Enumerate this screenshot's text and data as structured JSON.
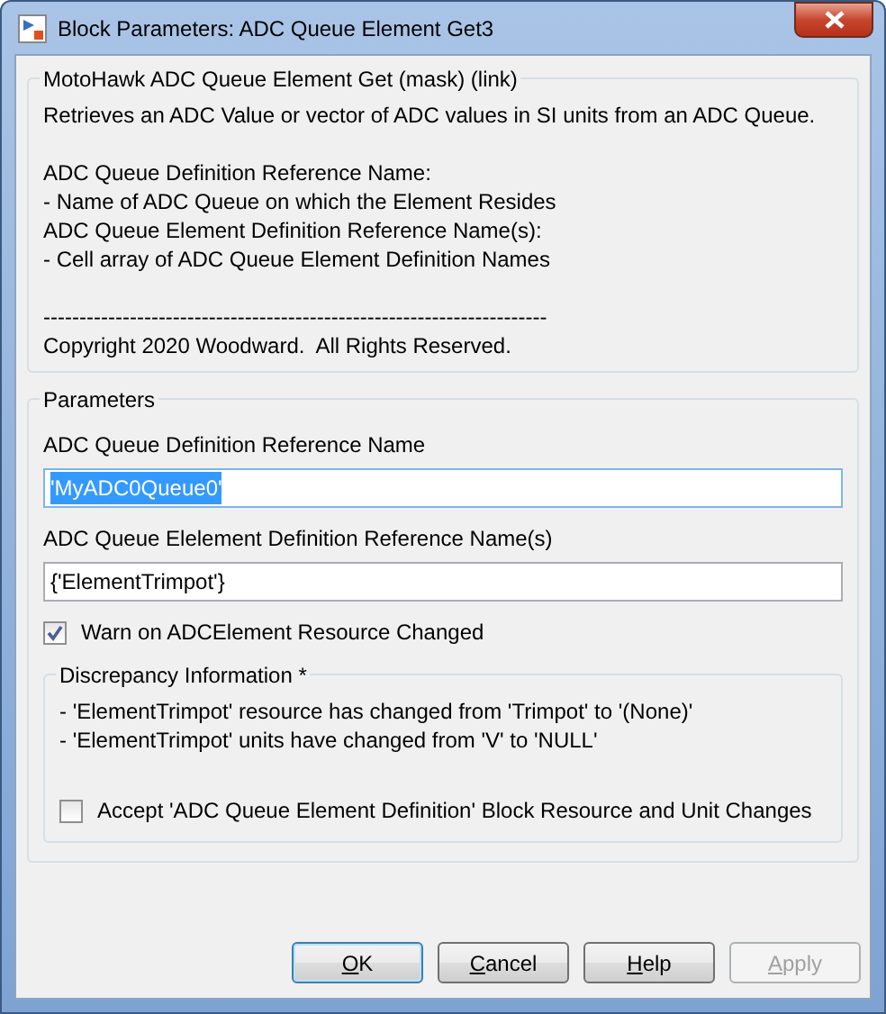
{
  "window": {
    "title": "Block Parameters: ADC Queue Element Get3"
  },
  "description": {
    "title": "MotoHawk ADC Queue Element Get (mask) (link)",
    "paragraphs": [
      [
        "Retrieves an ADC Value or vector of ADC values in SI units from an ADC Queue."
      ],
      [
        "ADC Queue Definition Reference Name:",
        "- Name of ADC Queue on which the Element Resides",
        "ADC Queue Element Definition Reference Name(s):",
        "- Cell array of ADC Queue Element Definition Names"
      ],
      [
        "----------------------------------------------------------------------",
        "Copyright 2020 Woodward.  All Rights Reserved."
      ]
    ]
  },
  "parameters": {
    "title": "Parameters",
    "fields": [
      {
        "label": "ADC Queue Definition Reference Name",
        "value": "'MyADC0Queue0'",
        "selected": true
      },
      {
        "label": "ADC Queue Elelement Definition Reference Name(s)",
        "value": "{'ElementTrimpot'}",
        "selected": false
      }
    ],
    "warn_checkbox": {
      "label": "Warn on ADCElement Resource Changed",
      "checked": true
    },
    "discrepancy": {
      "title": "Discrepancy Information *",
      "lines": [
        "- 'ElementTrimpot' resource has changed from 'Trimpot' to '(None)'",
        "- 'ElementTrimpot' units have changed from 'V' to 'NULL'"
      ],
      "accept_checkbox": {
        "label": "Accept 'ADC Queue Element Definition' Block Resource and Unit Changes",
        "checked": false
      }
    }
  },
  "buttons": [
    {
      "label": "OK",
      "default": true,
      "disabled": false,
      "underline_first": true
    },
    {
      "label": "Cancel",
      "default": false,
      "disabled": false,
      "underline_first": true
    },
    {
      "label": "Help",
      "default": false,
      "disabled": false,
      "underline_first": true
    },
    {
      "label": "Apply",
      "default": false,
      "disabled": true,
      "underline_first": true
    }
  ]
}
